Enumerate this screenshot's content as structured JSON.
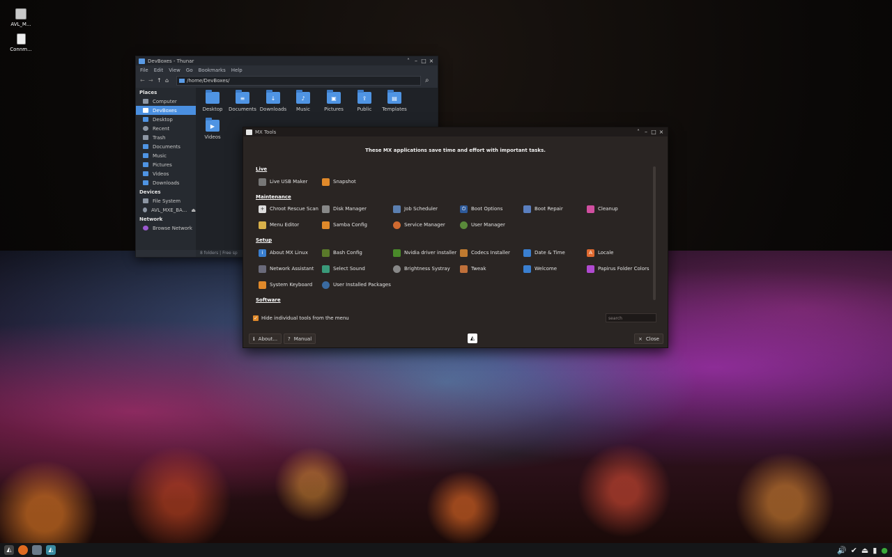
{
  "desktop": {
    "icons": [
      {
        "label": "AVL_M...",
        "icon": "drive-icon"
      },
      {
        "label": "Connm...",
        "icon": "document-icon"
      }
    ]
  },
  "thunar": {
    "title": "DevBoxes - Thunar",
    "menu": [
      "File",
      "Edit",
      "View",
      "Go",
      "Bookmarks",
      "Help"
    ],
    "path": "/home/DevBoxes/",
    "sidebar": {
      "places_header": "Places",
      "places": [
        "Computer",
        "DevBoxes",
        "Desktop",
        "Recent",
        "Trash",
        "Documents",
        "Music",
        "Pictures",
        "Videos",
        "Downloads"
      ],
      "selected": "DevBoxes",
      "devices_header": "Devices",
      "devices": [
        "File System",
        "AVL_MXE_BA..."
      ],
      "network_header": "Network",
      "network": [
        "Browse Network"
      ]
    },
    "folders": [
      "Desktop",
      "Documents",
      "Downloads",
      "Music",
      "Pictures",
      "Public",
      "Templates",
      "Videos"
    ],
    "status": "8 folders  |  Free sp"
  },
  "mxtools": {
    "title": "MX Tools",
    "header": "These MX applications save time and effort with important tasks.",
    "sections": {
      "live": "Live",
      "maintenance": "Maintenance",
      "setup": "Setup",
      "software": "Software"
    },
    "live": [
      "Live USB Maker",
      "Snapshot"
    ],
    "maintenance": [
      "Chroot Rescue Scan",
      "Disk Manager",
      "Job Scheduler",
      "Boot Options",
      "Boot Repair",
      "Cleanup",
      "Menu Editor",
      "Samba Config",
      "Service Manager",
      "User Manager"
    ],
    "setup": [
      "About MX Linux",
      "Bash Config",
      "Nvidia driver installer",
      "Codecs Installer",
      "Date & Time",
      "Locale",
      "Network Assistant",
      "Select Sound",
      "Brightness Systray",
      "Tweak",
      "Welcome",
      "Papirus Folder Colors",
      "System Keyboard",
      "User Installed Packages"
    ],
    "hide_checkbox": "Hide individual tools from the menu",
    "search_placeholder": "search",
    "about_btn": "About...",
    "manual_btn": "Manual",
    "close_btn": "Close",
    "accent": "#e0892a"
  }
}
